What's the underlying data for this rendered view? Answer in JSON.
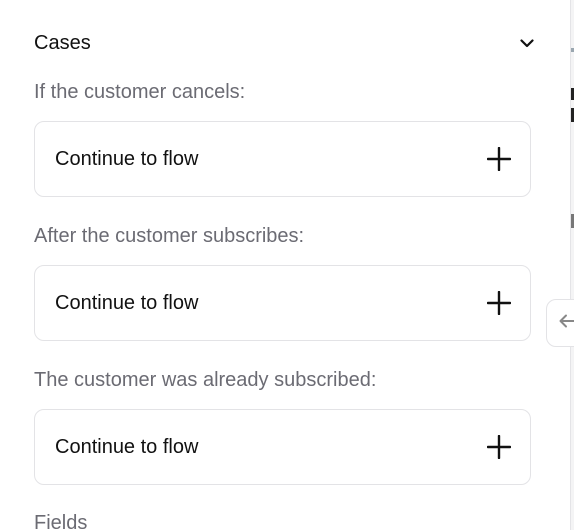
{
  "section": {
    "title": "Cases",
    "expanded": true
  },
  "cases": [
    {
      "label": "If the customer cancels:",
      "action": "Continue to flow"
    },
    {
      "label": "After the customer subscribes:",
      "action": "Continue to flow"
    },
    {
      "label": "The customer was already subscribed:",
      "action": "Continue to flow"
    }
  ],
  "next_section": {
    "title": "Fields"
  },
  "icons": {
    "toggle": "chevron-down-icon",
    "add": "plus-icon",
    "collapse": "arrow-left-icon"
  }
}
